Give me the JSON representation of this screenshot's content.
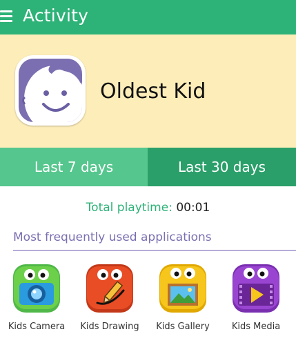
{
  "appbar": {
    "title": "Activity",
    "menu_icon": "hamburger-menu-icon"
  },
  "profile": {
    "name": "Oldest Kid",
    "avatar_icon": "smiling-face-avatar"
  },
  "tabs": [
    {
      "label": "Last 7 days",
      "selected": true
    },
    {
      "label": "Last 30 days",
      "selected": false
    }
  ],
  "playtime": {
    "label": "Total playtime:",
    "value": "00:01"
  },
  "section": {
    "title": "Most frequently used applications"
  },
  "apps": [
    {
      "label": "Kids Camera",
      "icon": "camera-icon"
    },
    {
      "label": "Kids Drawing",
      "icon": "pencil-icon"
    },
    {
      "label": "Kids Gallery",
      "icon": "picture-frame-icon"
    },
    {
      "label": "Kids Media",
      "icon": "play-icon"
    }
  ],
  "colors": {
    "primary": "#2db277",
    "profile_bg": "#fdedb9",
    "tab_active": "#55c68d",
    "tab_inactive": "#2a9f69",
    "accent_purple": "#7b6fb1"
  }
}
